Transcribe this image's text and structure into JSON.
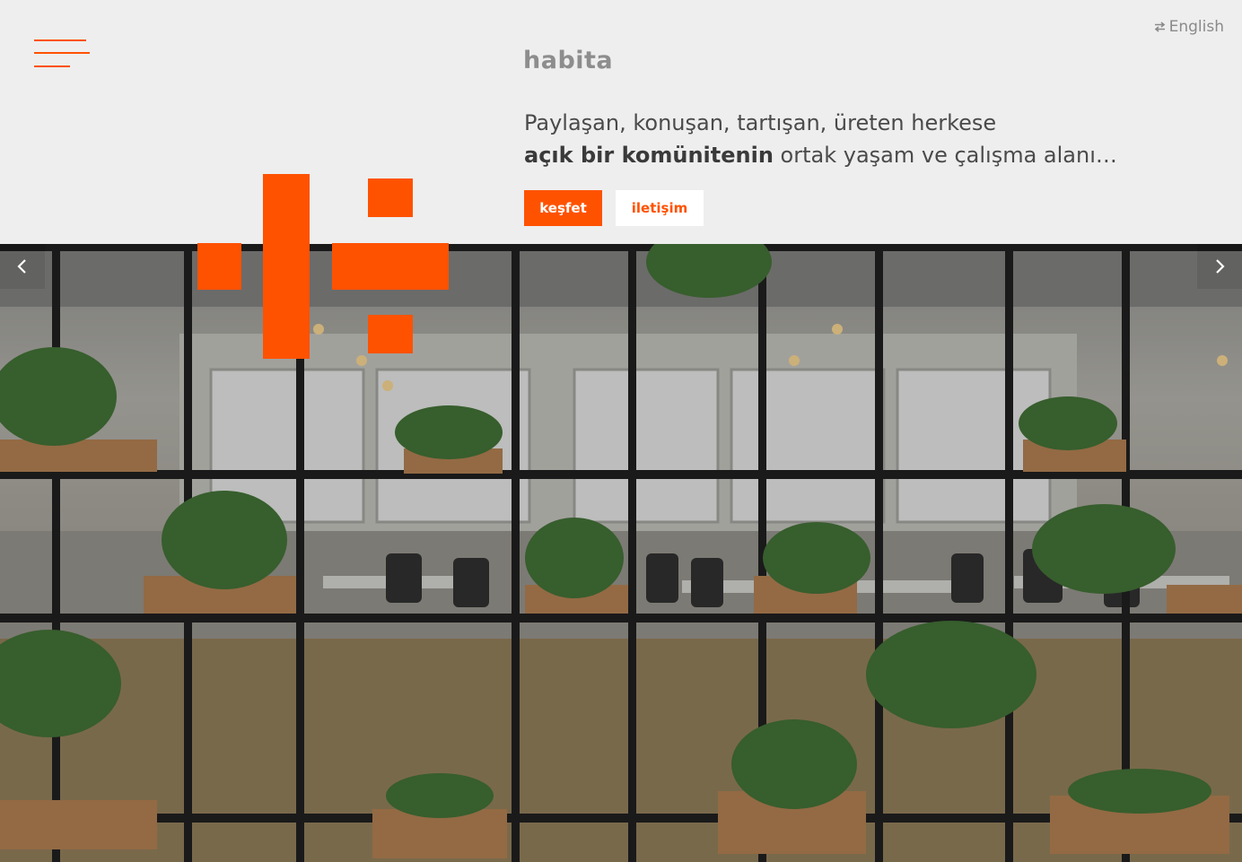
{
  "header": {
    "language_label": "English",
    "logo_text": "habita",
    "tagline_line1": "Paylaşan, konuşan, tartışan, üreten herkese",
    "tagline_bold": "açık bir komünitenin",
    "tagline_rest": " ortak yaşam ve çalışma alanı…",
    "explore_label": "keşfet",
    "contact_label": "iletişim"
  },
  "colors": {
    "accent": "#ff5200",
    "background": "#eeeeee",
    "text": "#4a4a4a"
  },
  "icons": {
    "menu": "hamburger-menu-icon",
    "language": "swap-arrows-icon",
    "prev": "chevron-left-icon",
    "next": "chevron-right-icon",
    "logo": "habita-brand-mark"
  },
  "hero": {
    "image_subject": "open-plan coworking office seen through black steel shelving with plants"
  }
}
